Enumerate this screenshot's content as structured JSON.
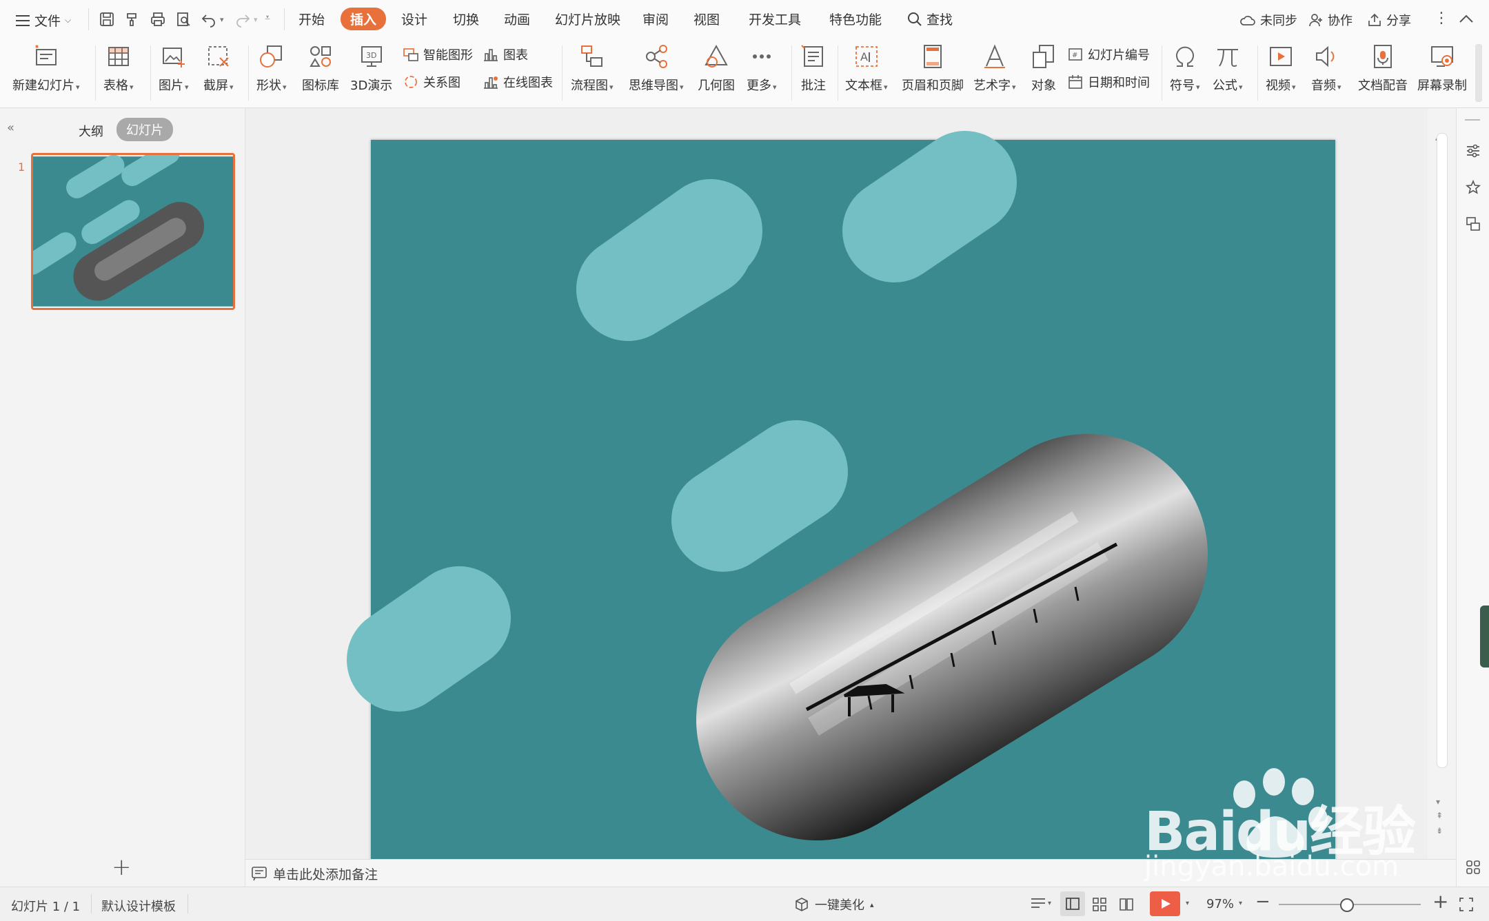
{
  "menubar": {
    "file_label": "文件",
    "tabs": [
      "开始",
      "插入",
      "设计",
      "切换",
      "动画",
      "幻灯片放映",
      "审阅",
      "视图",
      "开发工具",
      "特色功能"
    ],
    "active_tab": "插入",
    "search_label": "查找",
    "sync_label": "未同步",
    "collab_label": "协作",
    "share_label": "分享"
  },
  "ribbon": {
    "new_slide": "新建幻灯片",
    "table": "表格",
    "picture": "图片",
    "screenshot": "截屏",
    "shape": "形状",
    "icon_lib": "图标库",
    "demo3d": "3D演示",
    "smart_art": "智能图形",
    "chart": "图表",
    "relation": "关系图",
    "online_chart": "在线图表",
    "flowchart": "流程图",
    "mindmap": "思维导图",
    "geometry": "几何图",
    "more": "更多",
    "comment": "批注",
    "textbox": "文本框",
    "header_footer": "页眉和页脚",
    "wordart": "艺术字",
    "object": "对象",
    "slide_number": "幻灯片编号",
    "datetime": "日期和时间",
    "symbol": "符号",
    "formula": "公式",
    "video": "视频",
    "audio": "音频",
    "doc_dub": "文档配音",
    "screen_record": "屏幕录制"
  },
  "leftpanel": {
    "outline_tab": "大纲",
    "slides_tab": "幻灯片",
    "slide_index": "1"
  },
  "notes": {
    "placeholder": "单击此处添加备注"
  },
  "statusbar": {
    "slide_counter": "幻灯片 1 / 1",
    "template": "默认设计模板",
    "beautify": "一键美化",
    "zoom": "97%"
  },
  "watermark": {
    "brand": "Baidu经验",
    "url": "jingyan.baidu.com"
  },
  "colors": {
    "accent": "#e8713b",
    "slide_bg": "#3b8a8f",
    "pill": "#73bfc4"
  }
}
